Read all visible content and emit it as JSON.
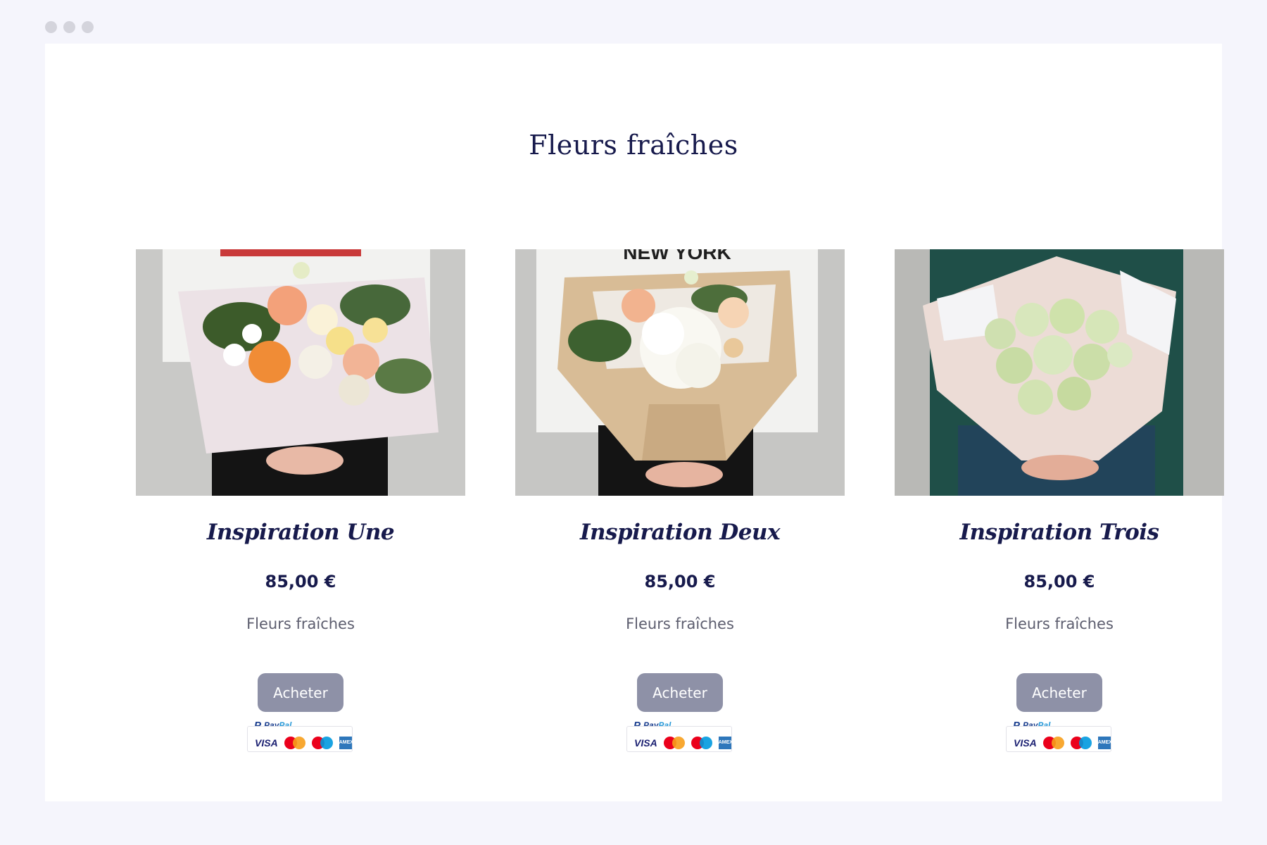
{
  "page": {
    "title": "Fleurs fraîches"
  },
  "colors": {
    "background": "#f5f5fc",
    "card": "#ffffff",
    "heading": "#171a4c",
    "muted_text": "#5c5d6e",
    "button": "#8e91a7",
    "button_text": "#ffffff"
  },
  "products": [
    {
      "name": "Inspiration Une",
      "price": "85,00 €",
      "category": "Fleurs fraîches",
      "button_label": "Acheter",
      "photo_shirt_text": ""
    },
    {
      "name": "Inspiration Deux",
      "price": "85,00 €",
      "category": "Fleurs fraîches",
      "button_label": "Acheter",
      "photo_shirt_text": "NEW YORK"
    },
    {
      "name": "Inspiration Trois",
      "price": "85,00 €",
      "category": "Fleurs fraîches",
      "button_label": "Acheter",
      "photo_shirt_text": ""
    }
  ],
  "payment": {
    "paypal_p": "P",
    "paypal_pay": "Pay",
    "paypal_pal": "Pal",
    "visa": "VISA",
    "amex": "AMEX",
    "icons": [
      "paypal-logo",
      "visa-logo",
      "mastercard-logo",
      "maestro-logo",
      "amex-logo"
    ]
  }
}
